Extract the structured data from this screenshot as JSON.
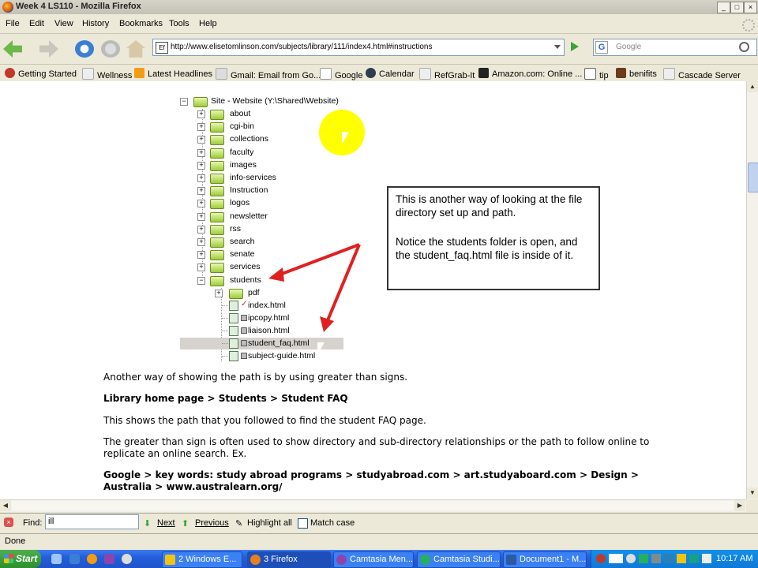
{
  "window": {
    "title": "Week 4 LS110 - Mozilla Firefox",
    "controls": [
      "_",
      "□",
      "×"
    ]
  },
  "menu": [
    "File",
    "Edit",
    "View",
    "History",
    "Bookmarks",
    "Tools",
    "Help"
  ],
  "nav": {
    "url": "http://www.elisetomlinson.com/subjects/library/111/index4.html#instructions",
    "search_placeholder": "Google"
  },
  "bookmarks": [
    "Getting Started",
    "Wellness",
    "Latest Headlines",
    "Gmail: Email from Go...",
    "Google",
    "Calendar",
    "RefGrab-It",
    "Amazon.com: Online ...",
    "tip",
    "benifits",
    "Cascade Server"
  ],
  "tree": {
    "root": "Site - Website (Y:\\Shared\\Website)",
    "folders": [
      "about",
      "cgi-bin",
      "collections",
      "faculty",
      "images",
      "info-services",
      "Instruction",
      "logos",
      "newsletter",
      "rss",
      "search",
      "senate",
      "services",
      "students"
    ],
    "subfolder": "pdf",
    "files": [
      "index.html",
      "ipcopy.html",
      "liaison.html",
      "student_faq.html",
      "subject-guide.html"
    ],
    "selected_file": "student_faq.html"
  },
  "callout": {
    "line1": "This is another way of looking at the file directory set up and path.",
    "line2": "Notice the students folder is open, and the student_faq.html file is inside of it."
  },
  "body": {
    "p1": "Another way of showing the path is by using greater than signs.",
    "p2": "Library home page > Students > Student FAQ",
    "p3": "This shows the path that you followed to find the student FAQ page.",
    "p4a": "The greater than sign is often used to show directory and sub-directory relationships or the path to follow online to",
    "p4b": "replicate an online search. Ex.",
    "p5a": "Google > key words: study abroad programs > studyabroad.com > art.studyaboard.com > Design >",
    "p5b": "Australia > www.australearn.org/"
  },
  "findbar": {
    "label": "Find:",
    "value": "ill",
    "next": "Next",
    "previous": "Previous",
    "highlight": "Highlight all",
    "match_case": "Match case"
  },
  "status": "Done",
  "taskbar": {
    "start": "Start",
    "tasks": [
      "2 Windows E...",
      "3 Firefox",
      "Camtasia Men...",
      "Camtasia Studi...",
      "Document1 - M..."
    ],
    "clock": "10:17 AM"
  },
  "colors": {
    "taskbar": "#245edb",
    "arrow": "#e02020",
    "highlight_circle": "#ffff00"
  }
}
